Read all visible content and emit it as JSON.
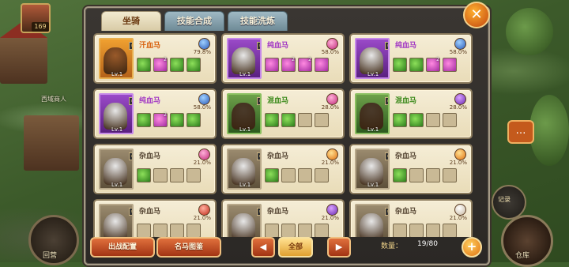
{
  "hud": {
    "level": "169",
    "npc_label": "西域商人",
    "bottom_left_label": "回营",
    "side_button_label": "记录",
    "warehouse_label": "仓库",
    "chat_icon": "chat-icon"
  },
  "tabs": [
    {
      "label": "坐骑",
      "active": true
    },
    {
      "label": "技能合成",
      "active": false
    },
    {
      "label": "技能洗炼",
      "active": false
    }
  ],
  "close_icon": "close-icon",
  "mounts": [
    {
      "name": "汗血马",
      "quality": "orange",
      "gem": "blue",
      "pct": "79.8%",
      "level": "Lv.1",
      "slots": [
        {
          "c": "green",
          "n": ""
        },
        {
          "c": "pink",
          "n": "2"
        },
        {
          "c": "green",
          "n": ""
        },
        {
          "c": "green",
          "n": ""
        }
      ]
    },
    {
      "name": "纯血马",
      "quality": "purple",
      "gem": "pink",
      "pct": "58.0%",
      "level": "Lv.1",
      "slots": [
        {
          "c": "pink",
          "n": ""
        },
        {
          "c": "pink",
          "n": "2"
        },
        {
          "c": "pink",
          "n": "2"
        },
        {
          "c": "pink",
          "n": ""
        }
      ]
    },
    {
      "name": "纯血马",
      "quality": "purple",
      "gem": "blue",
      "pct": "58.0%",
      "level": "Lv.1",
      "slots": [
        {
          "c": "green",
          "n": ""
        },
        {
          "c": "green",
          "n": ""
        },
        {
          "c": "pink",
          "n": "2"
        },
        {
          "c": "pink",
          "n": ""
        }
      ]
    },
    {
      "name": "纯血马",
      "quality": "purple",
      "gem": "blue",
      "pct": "58.0%",
      "level": "Lv.1",
      "slots": [
        {
          "c": "green",
          "n": ""
        },
        {
          "c": "pink",
          "n": "2"
        },
        {
          "c": "green",
          "n": ""
        },
        {
          "c": "green",
          "n": ""
        }
      ]
    },
    {
      "name": "混血马",
      "quality": "green",
      "gem": "pink",
      "pct": "28.0%",
      "level": "Lv.1",
      "slots": [
        {
          "c": "green",
          "n": ""
        },
        {
          "c": "green",
          "n": ""
        },
        {
          "c": "empty",
          "n": ""
        },
        {
          "c": "empty",
          "n": ""
        }
      ]
    },
    {
      "name": "混血马",
      "quality": "green",
      "gem": "purple",
      "pct": "28.0%",
      "level": "Lv.1",
      "slots": [
        {
          "c": "green",
          "n": ""
        },
        {
          "c": "green",
          "n": ""
        },
        {
          "c": "empty",
          "n": ""
        },
        {
          "c": "empty",
          "n": ""
        }
      ]
    },
    {
      "name": "杂血马",
      "quality": "white",
      "gem": "pink",
      "pct": "21.0%",
      "level": "Lv.1",
      "slots": [
        {
          "c": "green",
          "n": ""
        },
        {
          "c": "empty",
          "n": ""
        },
        {
          "c": "empty",
          "n": ""
        },
        {
          "c": "empty",
          "n": ""
        }
      ]
    },
    {
      "name": "杂血马",
      "quality": "white",
      "gem": "orange",
      "pct": "21.0%",
      "level": "Lv.1",
      "slots": [
        {
          "c": "green",
          "n": ""
        },
        {
          "c": "empty",
          "n": ""
        },
        {
          "c": "empty",
          "n": ""
        },
        {
          "c": "empty",
          "n": ""
        }
      ]
    },
    {
      "name": "杂血马",
      "quality": "white",
      "gem": "orange",
      "pct": "21.0%",
      "level": "Lv.1",
      "slots": [
        {
          "c": "green",
          "n": ""
        },
        {
          "c": "empty",
          "n": ""
        },
        {
          "c": "empty",
          "n": ""
        },
        {
          "c": "empty",
          "n": ""
        }
      ]
    },
    {
      "name": "杂血马",
      "quality": "white",
      "gem": "red",
      "pct": "21.0%",
      "level": "Lv.1",
      "slots": [
        {
          "c": "empty",
          "n": ""
        },
        {
          "c": "empty",
          "n": ""
        },
        {
          "c": "empty",
          "n": ""
        },
        {
          "c": "empty",
          "n": ""
        }
      ]
    },
    {
      "name": "杂血马",
      "quality": "white",
      "gem": "purple",
      "pct": "21.0%",
      "level": "Lv.1",
      "slots": [
        {
          "c": "empty",
          "n": ""
        },
        {
          "c": "empty",
          "n": ""
        },
        {
          "c": "empty",
          "n": ""
        },
        {
          "c": "empty",
          "n": ""
        }
      ]
    },
    {
      "name": "杂血马",
      "quality": "white",
      "gem": "white",
      "pct": "21.0%",
      "level": "Lv.1",
      "slots": [
        {
          "c": "empty",
          "n": ""
        },
        {
          "c": "empty",
          "n": ""
        },
        {
          "c": "empty",
          "n": ""
        },
        {
          "c": "empty",
          "n": ""
        }
      ]
    }
  ],
  "bottom": {
    "deploy_label": "出战配置",
    "gallery_label": "名马图鉴",
    "prev_icon": "arrow-left-icon",
    "next_icon": "arrow-right-icon",
    "filter_label": "全部",
    "count_label": "数量：",
    "count_value": "19/80",
    "add_icon": "plus-icon"
  }
}
